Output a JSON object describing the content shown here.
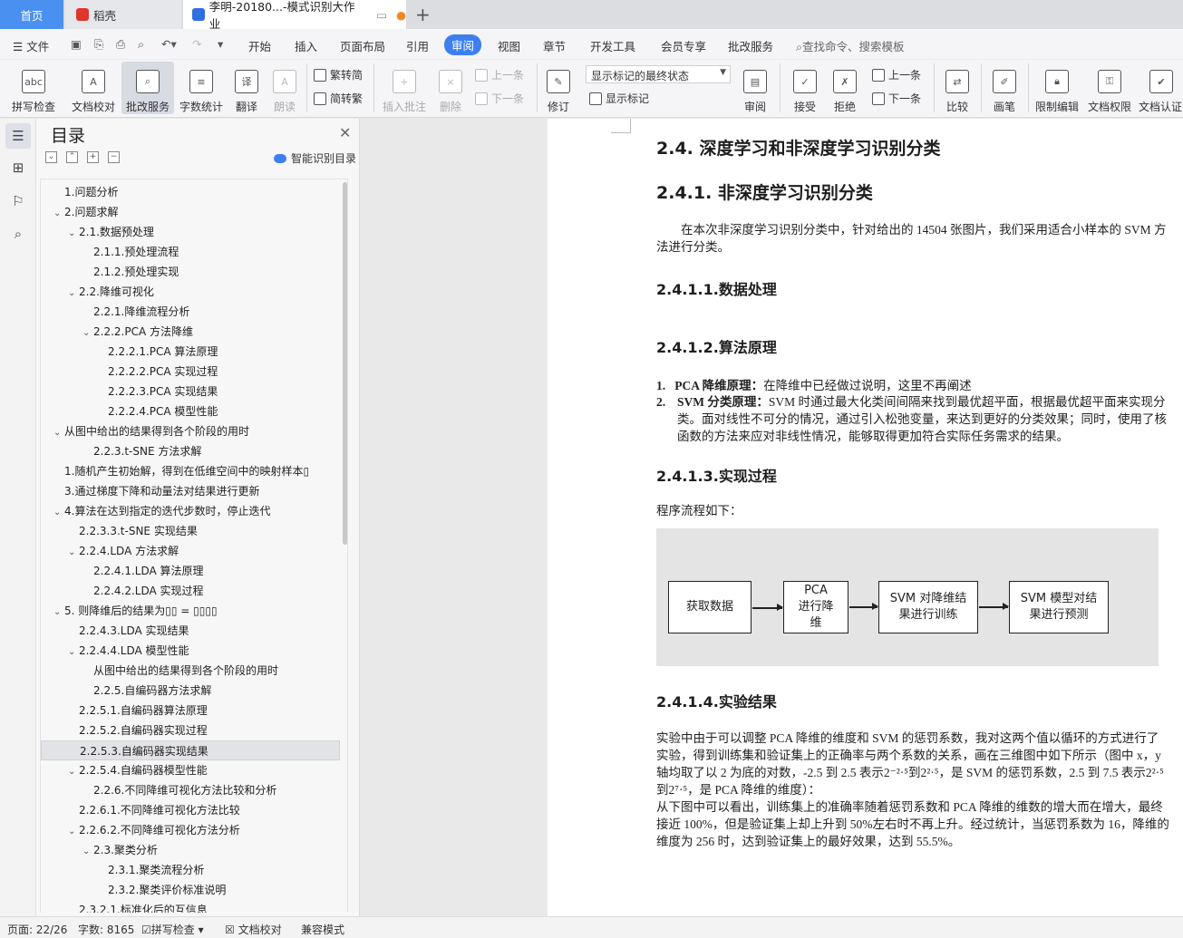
{
  "tabs": {
    "home": "首页",
    "daoke": "稻壳",
    "doc": "李明-20180...-模式识别大作业",
    "new_tab": "+"
  },
  "menu": {
    "file": "文件",
    "items": [
      "开始",
      "插入",
      "页面布局",
      "引用",
      "审阅",
      "视图",
      "章节",
      "开发工具",
      "会员专享",
      "批改服务"
    ],
    "active": "审阅",
    "search": "查找命令、搜索模板"
  },
  "ribbon": {
    "spell": "拼写检查",
    "doc_check": "文档校对",
    "correct_service": "批改服务",
    "word_count": "字数统计",
    "translate": "翻译",
    "read_aloud": "朗读",
    "trad": "繁转简",
    "simp": "简转繁",
    "insert_comment": "插入批注",
    "delete": "删除",
    "prev_comment": "上一条",
    "next_comment": "下一条",
    "revise": "修订",
    "markup_dropdown": "显示标记的最终状态",
    "show_markup": "显示标记",
    "review": "审阅",
    "accept": "接受",
    "reject": "拒绝",
    "prev_change": "上一条",
    "next_change": "下一条",
    "compare": "比较",
    "ink": "画笔",
    "restrict_edit": "限制编辑",
    "doc_permission": "文档权限",
    "doc_cert": "文档认证"
  },
  "toc": {
    "title": "目录",
    "smart": "智能识别目录",
    "items": [
      {
        "text": "1.问题分析",
        "caret": ""
      },
      {
        "text": "2.问题求解",
        "caret": "v"
      },
      {
        "text": "2.1.数据预处理",
        "caret": "v"
      },
      {
        "text": "2.1.1.预处理流程",
        "caret": ""
      },
      {
        "text": "2.1.2.预处理实现",
        "caret": ""
      },
      {
        "text": "2.2.降维可视化",
        "caret": "v"
      },
      {
        "text": "2.2.1.降维流程分析",
        "caret": ""
      },
      {
        "text": "2.2.2.PCA 方法降维",
        "caret": "v"
      },
      {
        "text": "2.2.2.1.PCA 算法原理",
        "caret": ""
      },
      {
        "text": "2.2.2.2.PCA 实现过程",
        "caret": ""
      },
      {
        "text": "2.2.2.3.PCA 实现结果",
        "caret": ""
      },
      {
        "text": "2.2.2.4.PCA 模型性能",
        "caret": ""
      },
      {
        "text": "从图中给出的结果得到各个阶段的用时",
        "caret": "v"
      },
      {
        "text": "2.2.3.t-SNE 方法求解",
        "caret": ""
      },
      {
        "text": "1.随机产生初始解，得到在低维空间中的映射样本▯",
        "caret": ""
      },
      {
        "text": "3.通过梯度下降和动量法对结果进行更新",
        "caret": ""
      },
      {
        "text": "4.算法在达到指定的迭代步数时，停止迭代",
        "caret": "v"
      },
      {
        "text": "2.2.3.3.t-SNE 实现结果",
        "caret": ""
      },
      {
        "text": "2.2.4.LDA 方法求解",
        "caret": "v"
      },
      {
        "text": "2.2.4.1.LDA 算法原理",
        "caret": ""
      },
      {
        "text": "2.2.4.2.LDA 实现过程",
        "caret": ""
      },
      {
        "text": "5. 则降维后的结果为▯▯ = ▯▯▯▯",
        "caret": "v"
      },
      {
        "text": "2.2.4.3.LDA 实现结果",
        "caret": ""
      },
      {
        "text": "2.2.4.4.LDA 模型性能",
        "caret": "v"
      },
      {
        "text": "从图中给出的结果得到各个阶段的用时",
        "caret": ""
      },
      {
        "text": "2.2.5.自编码器方法求解",
        "caret": ""
      },
      {
        "text": "2.2.5.1.自编码器算法原理",
        "caret": ""
      },
      {
        "text": "2.2.5.2.自编码器实现过程",
        "caret": ""
      },
      {
        "text": "2.2.5.3.自编码器实现结果",
        "caret": ""
      },
      {
        "text": "2.2.5.4.自编码器模型性能",
        "caret": "v"
      },
      {
        "text": "2.2.6.不同降维可视化方法比较和分析",
        "caret": ""
      },
      {
        "text": "2.2.6.1.不同降维可视化方法比较",
        "caret": ""
      },
      {
        "text": "2.2.6.2.不同降维可视化方法分析",
        "caret": "v"
      },
      {
        "text": "2.3.聚类分析",
        "caret": "v"
      },
      {
        "text": "2.3.1.聚类流程分析",
        "caret": ""
      },
      {
        "text": "2.3.2.聚类评价标准说明",
        "caret": ""
      },
      {
        "text": "2.3.2.1.标准化后的互信息",
        "caret": ""
      }
    ]
  },
  "doc": {
    "h_24": "2.4. 深度学习和非深度学习识别分类",
    "h_241": "2.4.1. 非深度学习识别分类",
    "intro": "在本次非深度学习识别分类中，针对给出的 14504 张图片，我们采用适合小样本的 SVM 方法进行分类。",
    "h_2411": "2.4.1.1.数据处理",
    "h_2412": "2.4.1.2.算法原理",
    "li1_num": "1.",
    "li1_bold": "PCA 降维原理：",
    "li1_text": "在降维中已经做过说明，这里不再阐述",
    "li2_num": "2.",
    "li2_bold": "SVM 分类原理：",
    "li2_text": "SVM 时通过最大化类间间隔来找到最优超平面，根据最优超平面来实现分类。面对线性不可分的情况，通过引入松弛变量，来达到更好的分类效果；同时，使用了核函数的方法来应对非线性情况，能够取得更加符合实际任务需求的结果。",
    "h_2413": "2.4.1.3.实现过程",
    "flow_intro": "程序流程如下：",
    "flow": [
      "获取数据",
      "PCA 进行降维",
      "SVM 对降维结果进行训练",
      "SVM 模型对结果进行预测"
    ],
    "h_2414": "2.4.1.4.实验结果",
    "res1": "实验中由于可以调整 PCA 降维的维度和 SVM 的惩罚系数，我对这两个值以循环的方式进行了实验，得到训练集和验证集上的正确率与两个系数的关系，画在三维图中如下所示（图中 x，y 轴均取了以 2 为底的对数，-2.5 到 2.5 表示2⁻²·⁵到2²·⁵，是 SVM 的惩罚系数，2.5 到 7.5 表示2²·⁵到2⁷·⁵，是 PCA 降维的维度）：",
    "res2": "从下图中可以看出，训练集上的准确率随着惩罚系数和 PCA 降维的维数的增大而在增大，最终接近 100%，但是验证集上却上升到 50%左右时不再上升。经过统计，当惩罚系数为 16，降维的维度为 256 时，达到验证集上的最好效果，达到 55.5%。"
  },
  "status": {
    "page": "页面: 22/26",
    "words": "字数: 8165",
    "spell": "拼写检查",
    "doc_check": "文档校对",
    "compat": "兼容模式"
  }
}
